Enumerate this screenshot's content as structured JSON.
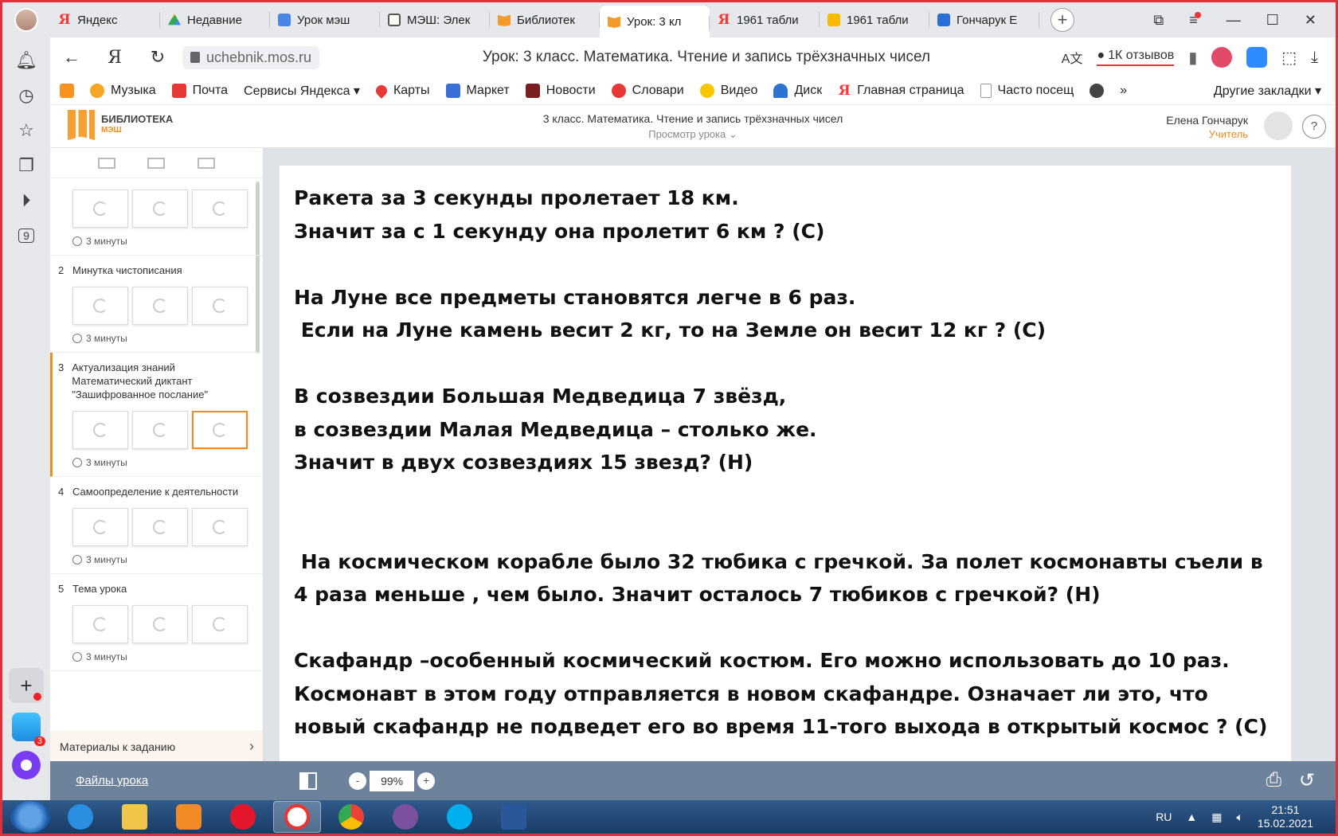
{
  "tabs": [
    {
      "label": "Яндекс",
      "icon": "yandex-icon"
    },
    {
      "label": "Недавние",
      "icon": "google-drive-icon"
    },
    {
      "label": "Урок мэш",
      "icon": "google-docs-icon"
    },
    {
      "label": "МЭШ: Элек",
      "icon": "sheet-icon"
    },
    {
      "label": "Библиотек",
      "icon": "mesh-library-icon"
    },
    {
      "label": "Урок: 3 кл",
      "icon": "mesh-library-icon",
      "active": true
    },
    {
      "label": "1961 табли",
      "icon": "yandex-icon"
    },
    {
      "label": "1961 табли",
      "icon": "image-icon"
    },
    {
      "label": "Гончарук Е",
      "icon": "word-doc-icon"
    }
  ],
  "address": {
    "url": "uchebnik.mos.ru",
    "page_title": "Урок: 3 класс. Математика. Чтение и запись трёхзначных чисел",
    "reviews": "1К отзывов"
  },
  "bookmarks": [
    {
      "label": "",
      "icon": "odnoklassniki-icon",
      "color": "#f7931e"
    },
    {
      "label": "Музыка",
      "icon": "music-icon",
      "color": "#f6a623"
    },
    {
      "label": "Почта",
      "icon": "mail-icon",
      "color": "#e53935"
    },
    {
      "label": "Сервисы Яндекса ▾",
      "icon": "",
      "color": ""
    },
    {
      "label": "Карты",
      "icon": "maps-pin-icon",
      "color": "#e53935"
    },
    {
      "label": "Маркет",
      "icon": "market-cart-icon",
      "color": "#3a6fd8"
    },
    {
      "label": "Новости",
      "icon": "news-icon",
      "color": "#7a1f1f"
    },
    {
      "label": "Словари",
      "icon": "dictionary-icon",
      "color": "#e53935"
    },
    {
      "label": "Видео",
      "icon": "video-play-icon",
      "color": "#f7c600"
    },
    {
      "label": "Диск",
      "icon": "disk-icon",
      "color": "#2c73d2"
    },
    {
      "label": "Главная страница",
      "icon": "yandex-icon",
      "color": "#e53935"
    },
    {
      "label": "Часто посещ",
      "icon": "page-icon",
      "color": "#999999"
    }
  ],
  "bookmarks_more": "Другие закладки ▾",
  "header": {
    "logo_title": "БИБЛИОТЕКА",
    "logo_sub": "МЭШ",
    "lesson_title": "3 класс. Математика. Чтение и запись трёхзначных чисел",
    "lesson_sub": "Просмотр урока ⌄",
    "user_name": "Елена Гончарук",
    "user_role": "Учитель",
    "help": "?"
  },
  "steps": [
    {
      "num": "",
      "title": "",
      "duration": "3 минуты",
      "active": false
    },
    {
      "num": "2",
      "title": "Минутка чистописания",
      "duration": "3 минуты",
      "active": false
    },
    {
      "num": "3",
      "title": "Актуализация знаний Математический диктант \"Зашифрованное послание\"",
      "duration": "3 минуты",
      "active": true
    },
    {
      "num": "4",
      "title": "Самоопределение к деятельности",
      "duration": "3 минуты",
      "active": false
    },
    {
      "num": "5",
      "title": "Тема урока",
      "duration": "3 минуты",
      "active": false
    }
  ],
  "materials": "Материалы к заданию",
  "slide": {
    "paragraphs": [
      "Ракета за 3 секунды пролетает 18 км.",
      "Значит за с 1 секунду она пролетит 6 км ? (С)",
      "",
      "На Луне все предметы становятся легче в 6 раз.",
      " Если на Луне камень весит 2 кг, то на Земле он весит 12 кг ? (С)",
      "",
      "В созвездии Большая Медведица 7 звёзд,",
      "в созвездии Малая Медведица – столько же.",
      "Значит в двух созвездиях 15 звезд? (Н)",
      "",
      "",
      " На космическом корабле было 32 тюбика с гречкой. За полет космонавты съели в 4 раза меньше , чем было. Значит осталось 7 тюбиков с гречкой? (Н)",
      "",
      "Скафандр –особенный космический костюм. Его можно использовать до 10 раз. Космонавт в этом году отправляется в новом скафандре. Означает ли это, что новый скафандр не подведет его во время 11-того выхода в открытый космос ? (С)"
    ]
  },
  "bottom_bar": {
    "files_link": "Файлы урока",
    "zoom_minus": "-",
    "zoom_value": "99%",
    "zoom_plus": "+"
  },
  "taskbar": {
    "lang": "RU",
    "time": "21:51",
    "date": "15.02.2021",
    "apps": [
      "ie-icon",
      "folder-icon",
      "media-player-icon",
      "opera-icon",
      "yandex-browser-icon",
      "chrome-icon",
      "viber-icon",
      "skype-icon",
      "word-icon"
    ]
  },
  "sidepanel_badge": "3",
  "sidepanel_num": "9"
}
